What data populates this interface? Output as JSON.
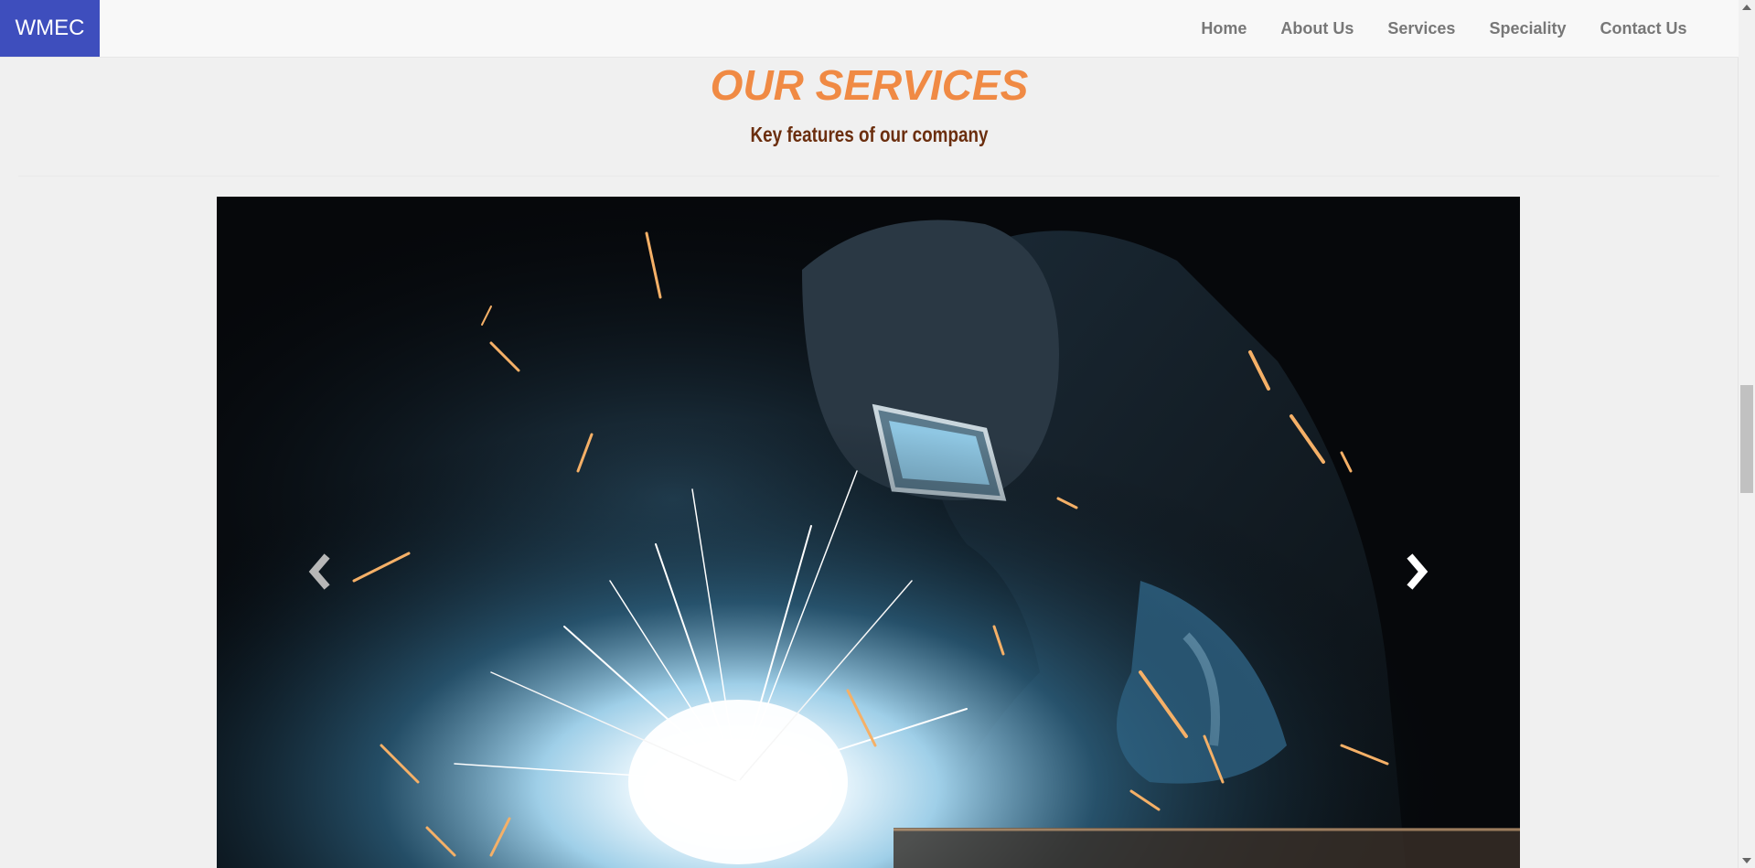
{
  "navbar": {
    "brand": "WMEC",
    "links": [
      "Home",
      "About Us",
      "Services",
      "Speciality",
      "Contact Us"
    ]
  },
  "section": {
    "title": "OUR SERVICES",
    "subtitle": "Key features of our company"
  },
  "carousel": {
    "image": "welder-with-sparks-photo",
    "prev_icon": "chevron-left-icon",
    "next_icon": "chevron-right-icon"
  },
  "colors": {
    "brand_bg": "#3e4ebd",
    "title": "#f08a44",
    "subtitle": "#6b2e0e",
    "nav_text": "#777777"
  }
}
